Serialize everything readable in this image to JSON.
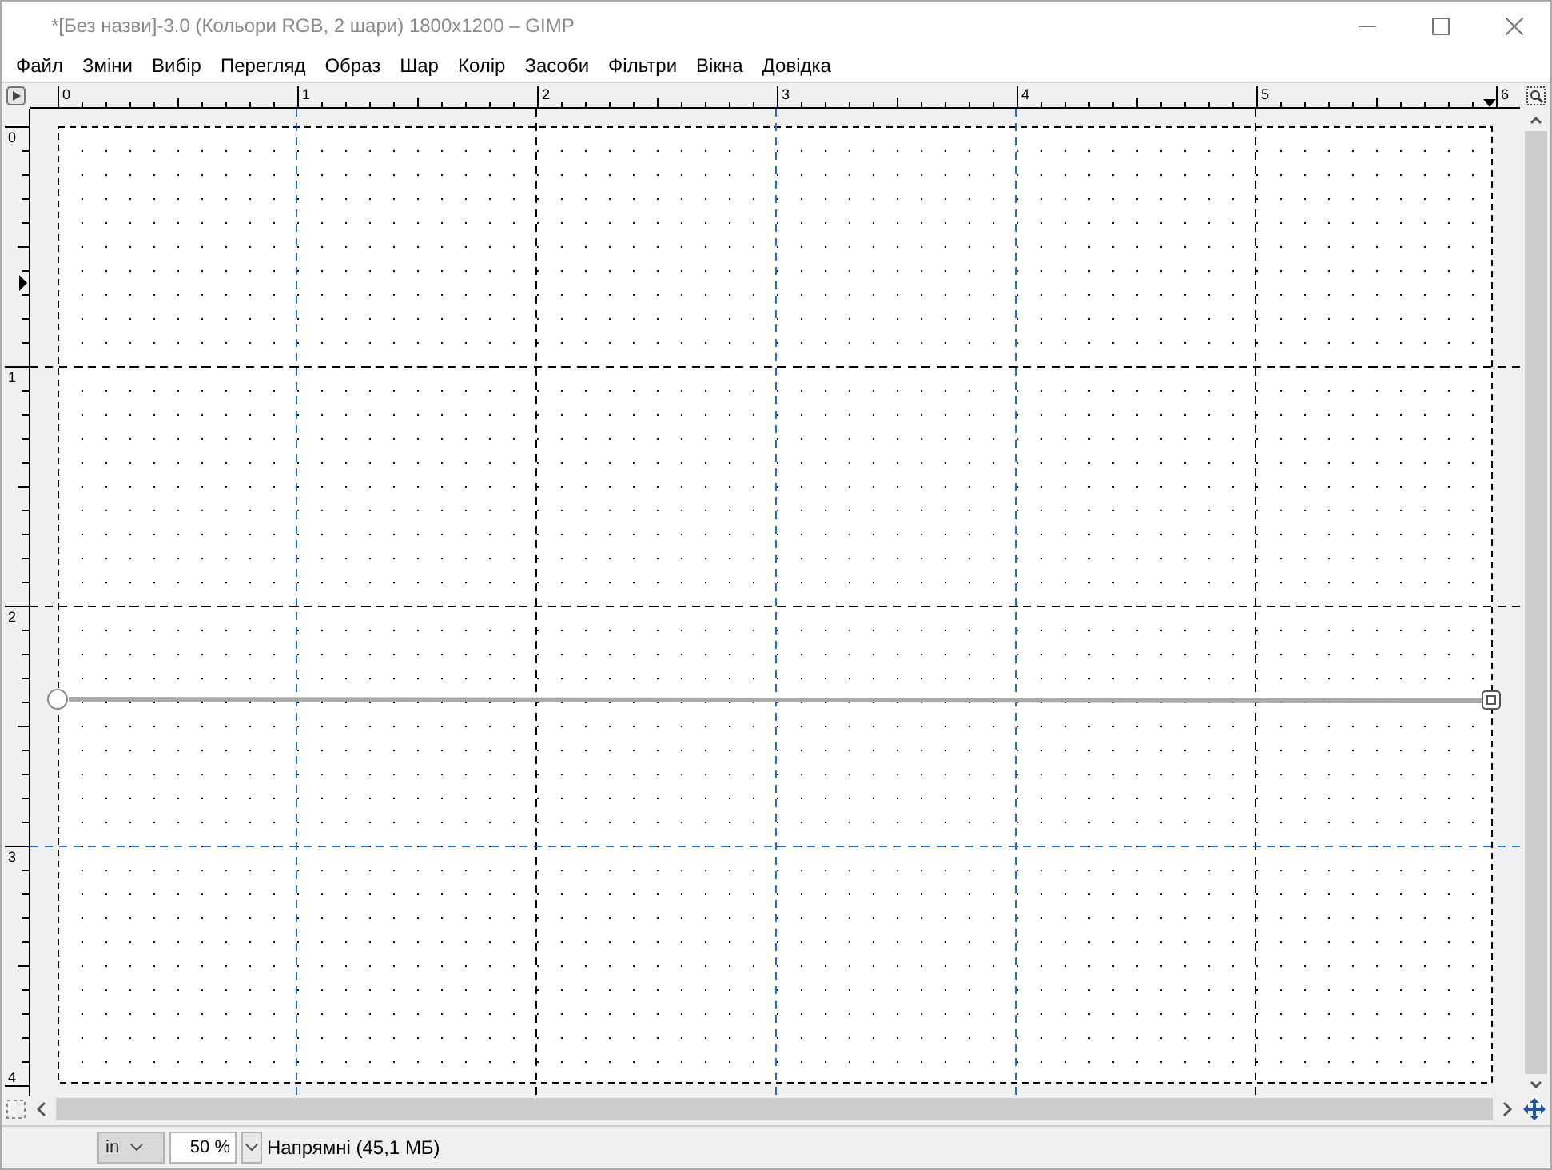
{
  "window": {
    "title": "*[Без назви]-3.0 (Кольори RGB, 2 шари) 1800x1200 – GIMP"
  },
  "menu": [
    {
      "label": "Файл"
    },
    {
      "label": "Зміни"
    },
    {
      "label": "Вибір"
    },
    {
      "label": "Перегляд"
    },
    {
      "label": "Образ"
    },
    {
      "label": "Шар"
    },
    {
      "label": "Колір"
    },
    {
      "label": "Засоби"
    },
    {
      "label": "Фільтри"
    },
    {
      "label": "Вікна"
    },
    {
      "label": "Довідка"
    }
  ],
  "horizontal_ruler": {
    "labels": [
      "0",
      "1",
      "2",
      "3",
      "4",
      "5",
      "6"
    ]
  },
  "vertical_ruler": {
    "labels": [
      "0",
      "1",
      "2",
      "3",
      "4"
    ]
  },
  "status_bar": {
    "unit": "in",
    "zoom": "50 %",
    "message": "Напрямні (45,1 МБ)"
  }
}
